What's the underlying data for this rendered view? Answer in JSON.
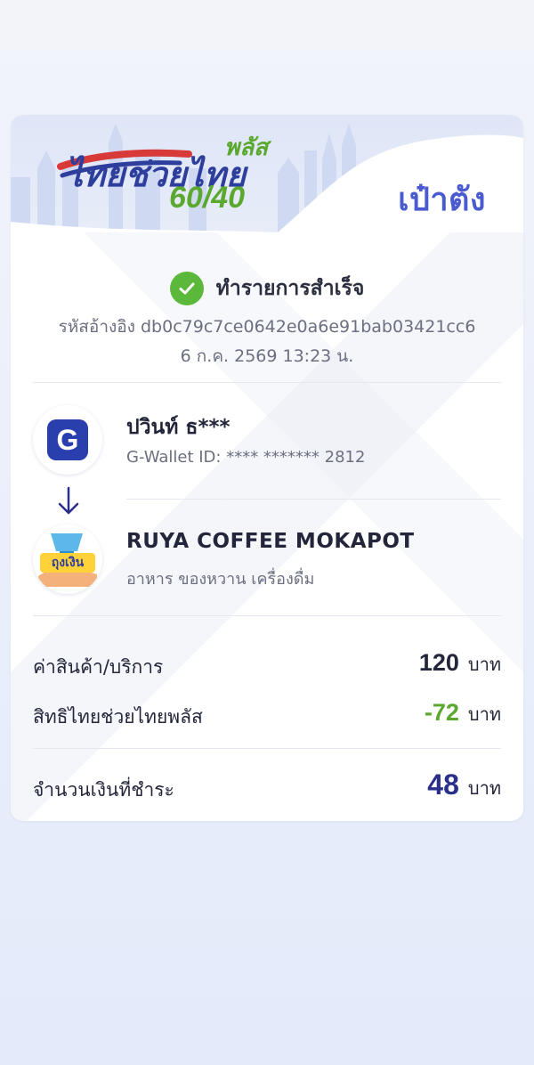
{
  "header": {
    "logo_line1": "ไทยช่วยไทย",
    "logo_plus": "พลัส",
    "logo_ratio": "60/40",
    "tag": "เป๋าตัง"
  },
  "status": {
    "text": "ทำรายการสำเร็จ",
    "reference": "รหัสอ้างอิง db0c79c7ce0642e0a6e91bab03421cc6",
    "datetime": "6 ก.ค. 2569 13:23 น."
  },
  "sender": {
    "name": "ปวินท์ ธ***",
    "wallet": "G-Wallet ID: **** ******* 2812",
    "logo_letter": "G"
  },
  "receiver": {
    "name": "RUYA COFFEE MOKAPOT",
    "category": "อาหาร ของหวาน เครื่องดื่ม",
    "logo_text": "ถุงเงิน"
  },
  "amounts": {
    "price_label": "ค่าสินค้า/บริการ",
    "price_value": "120",
    "discount_label": "สิทธิไทยช่วยไทยพลัส",
    "discount_value": "-72",
    "total_label": "จำนวนเงินที่ชำระ",
    "total_value": "48",
    "unit": "บาท"
  },
  "colors": {
    "accent": "#4a5bd0",
    "success": "#5cb83a",
    "discount": "#5aa82e",
    "total": "#2a2f8a"
  }
}
